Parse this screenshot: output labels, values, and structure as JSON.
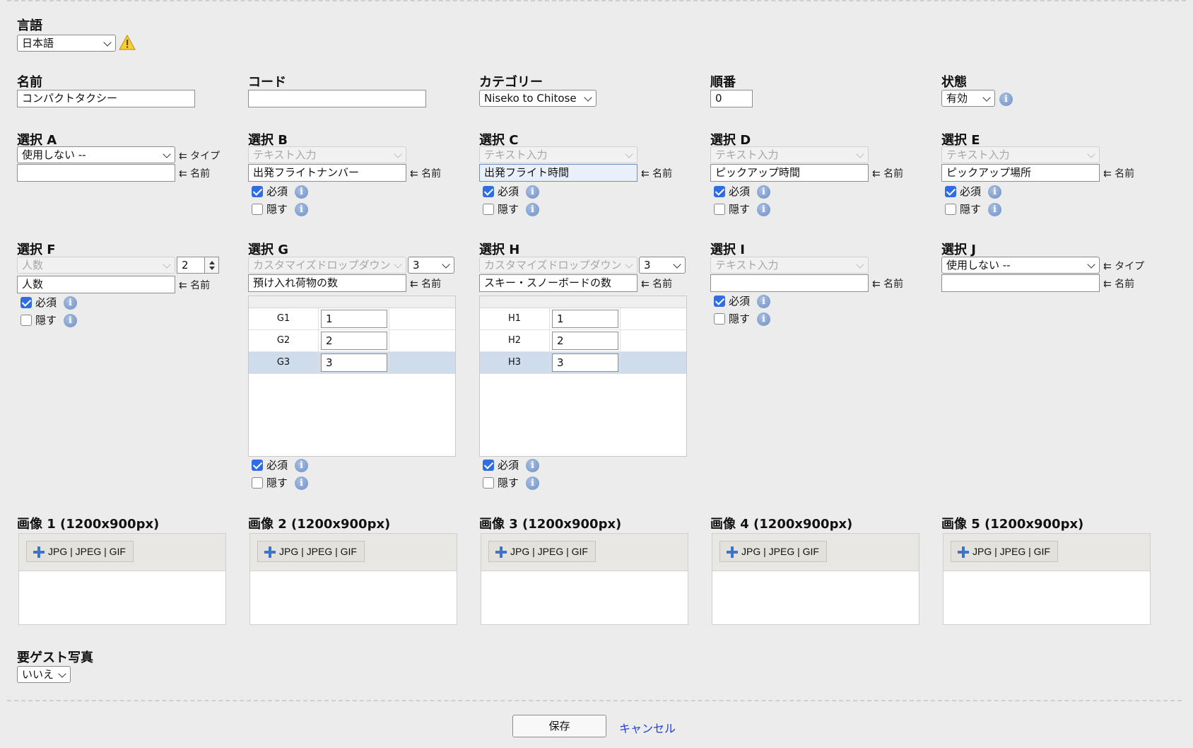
{
  "language": {
    "label": "言語",
    "value": "日本語"
  },
  "hints": {
    "type": "⇇ タイプ",
    "name": "⇇ 名前"
  },
  "checks": {
    "required": "必須",
    "hide": "隠す"
  },
  "fields": {
    "name": {
      "label": "名前",
      "value": "コンパクトタクシー"
    },
    "code": {
      "label": "コード",
      "value": ""
    },
    "category": {
      "label": "カテゴリー",
      "value": "Niseko to Chitose"
    },
    "order": {
      "label": "順番",
      "value": "0"
    },
    "status": {
      "label": "状態",
      "value": "有効"
    }
  },
  "selections": {
    "a": {
      "label": "選択 A",
      "type": "使用しない --",
      "name": ""
    },
    "b": {
      "label": "選択 B",
      "type": "テキスト入力",
      "name": "出発フライトナンバー",
      "required": true,
      "hidden": false
    },
    "c": {
      "label": "選択 C",
      "type": "テキスト入力",
      "name": "出発フライト時間",
      "required": true,
      "hidden": false
    },
    "d": {
      "label": "選択 D",
      "type": "テキスト入力",
      "name": "ピックアップ時間",
      "required": true,
      "hidden": false
    },
    "e": {
      "label": "選択 E",
      "type": "テキスト入力",
      "name": "ピックアップ場所",
      "required": true,
      "hidden": false
    },
    "f": {
      "label": "選択 F",
      "type": "人数",
      "count": "2",
      "name": "人数",
      "required": true,
      "hidden": false
    },
    "g": {
      "label": "選択 G",
      "type": "カスタマイズドロップダウン",
      "count": "3",
      "name": "預け入れ荷物の数",
      "required": true,
      "hidden": false,
      "options": [
        {
          "key": "G1",
          "value": "1"
        },
        {
          "key": "G2",
          "value": "2"
        },
        {
          "key": "G3",
          "value": "3"
        }
      ]
    },
    "h": {
      "label": "選択 H",
      "type": "カスタマイズドロップダウン",
      "count": "3",
      "name": "スキー・スノーボードの数",
      "required": true,
      "hidden": false,
      "options": [
        {
          "key": "H1",
          "value": "1"
        },
        {
          "key": "H2",
          "value": "2"
        },
        {
          "key": "H3",
          "value": "3"
        }
      ]
    },
    "i": {
      "label": "選択 I",
      "type": "テキスト入力",
      "name": "",
      "required": true,
      "hidden": false
    },
    "j": {
      "label": "選択 J",
      "type": "使用しない --",
      "name": ""
    }
  },
  "images": [
    {
      "label": "画像 1 (1200x900px)",
      "button": "JPG | JPEG | GIF"
    },
    {
      "label": "画像 2 (1200x900px)",
      "button": "JPG | JPEG | GIF"
    },
    {
      "label": "画像 3 (1200x900px)",
      "button": "JPG | JPEG | GIF"
    },
    {
      "label": "画像 4 (1200x900px)",
      "button": "JPG | JPEG | GIF"
    },
    {
      "label": "画像 5 (1200x900px)",
      "button": "JPG | JPEG | GIF"
    }
  ],
  "guest_photo": {
    "label": "要ゲスト写真",
    "value": "いいえ"
  },
  "actions": {
    "save": "保存",
    "cancel": "キャンセル"
  }
}
